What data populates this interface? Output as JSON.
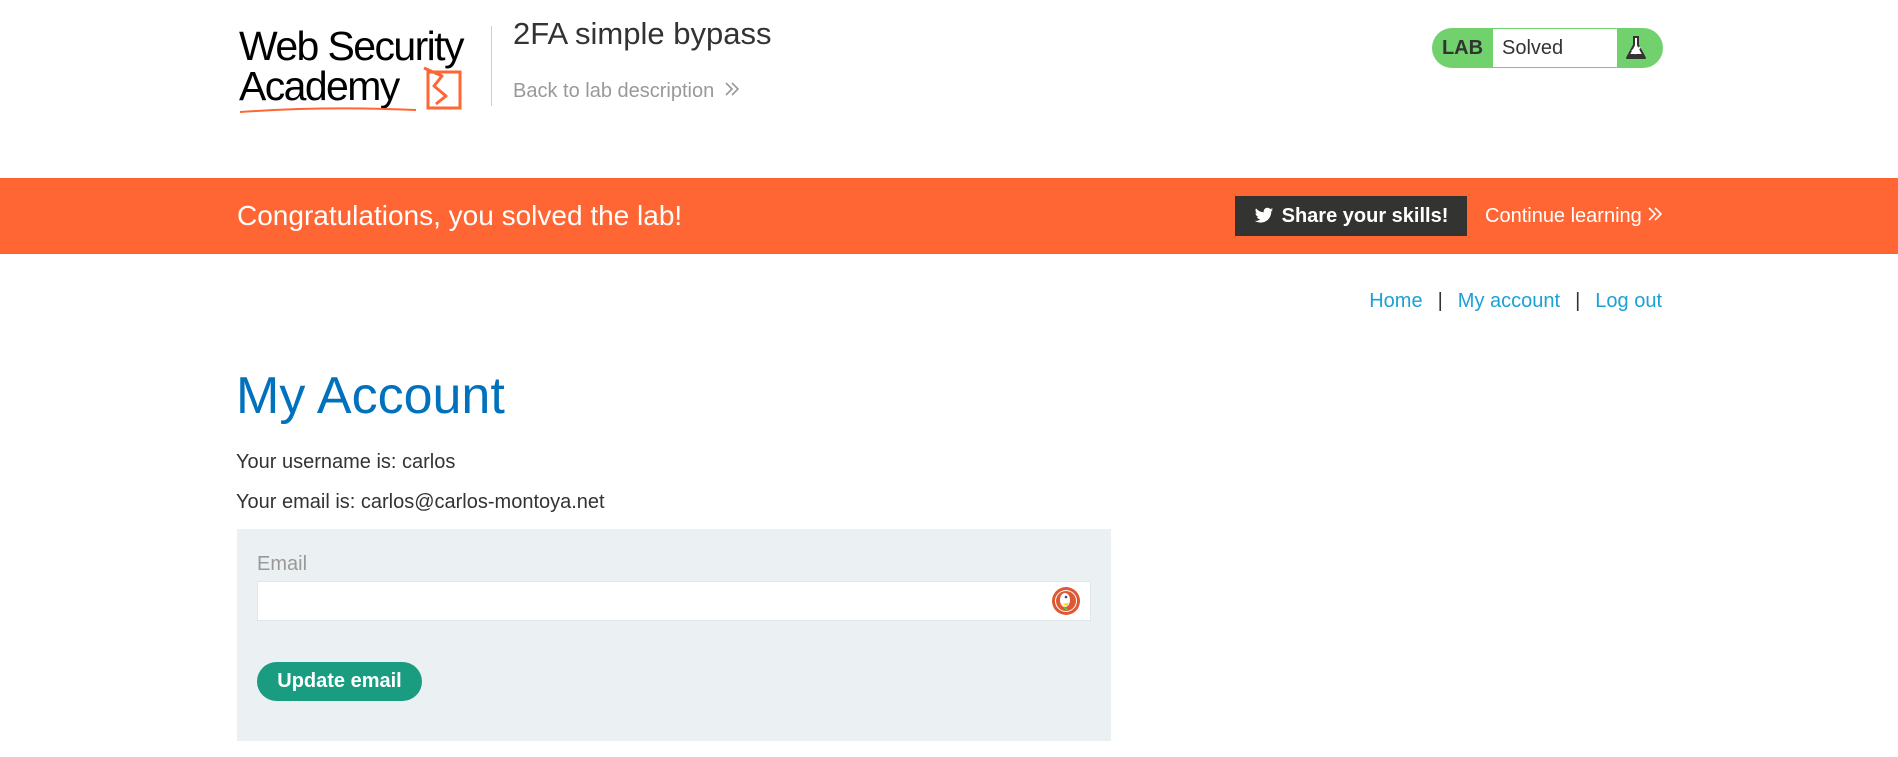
{
  "header": {
    "logo_text_line1": "Web Security",
    "logo_text_line2": "Academy",
    "lab_title": "2FA simple bypass",
    "back_link": "Back to lab description",
    "status": {
      "lab_label": "LAB",
      "status_text": "Solved"
    }
  },
  "banner": {
    "message": "Congratulations, you solved the lab!",
    "share_label": "Share your skills!",
    "continue_label": "Continue learning"
  },
  "nav": {
    "home": "Home",
    "separator": "|",
    "my_account": "My account",
    "log_out": "Log out"
  },
  "main": {
    "title": "My Account",
    "username_line": "Your username is: carlos",
    "email_line": "Your email is: carlos@carlos-montoya.net",
    "form": {
      "email_label": "Email",
      "email_value": "",
      "update_button": "Update email"
    }
  },
  "colors": {
    "accent_orange": "#ff6633",
    "solved_green": "#70d16d",
    "link_blue": "#1aa1d5",
    "title_blue": "#0071bc",
    "button_teal": "#1a9c81"
  },
  "icons": [
    "academy-logo",
    "flask-icon",
    "twitter-icon",
    "chevron-double-right-icon",
    "duckduckgo-icon"
  ]
}
